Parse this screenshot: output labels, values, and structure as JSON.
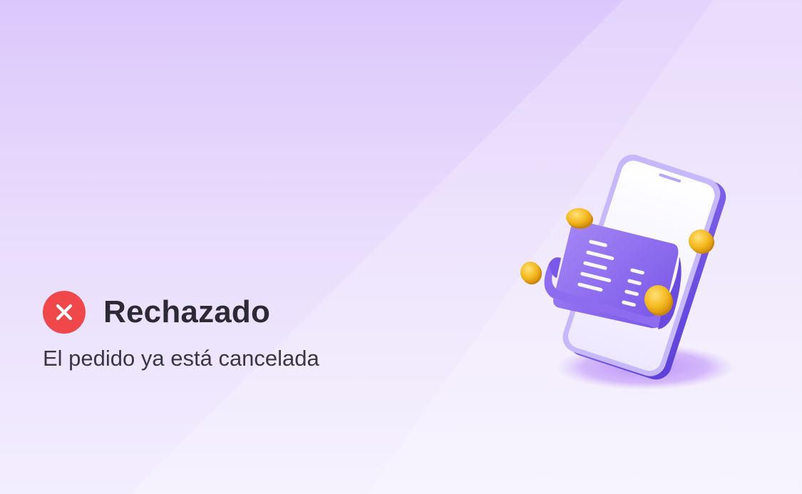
{
  "status": {
    "icon": "close-circle-icon",
    "title": "Rechazado",
    "message": "El pedido ya está cancelada"
  },
  "illustration": {
    "icon": "phone-receipt-coins-illustration"
  },
  "colors": {
    "background_top": "#dcc7fb",
    "background_bottom": "#f3eefe",
    "error": "#f0474b",
    "title_text": "#2d2935",
    "body_text": "#3a3644",
    "accent_purple": "#8d67ee",
    "coin_gold": "#f4b91f"
  }
}
